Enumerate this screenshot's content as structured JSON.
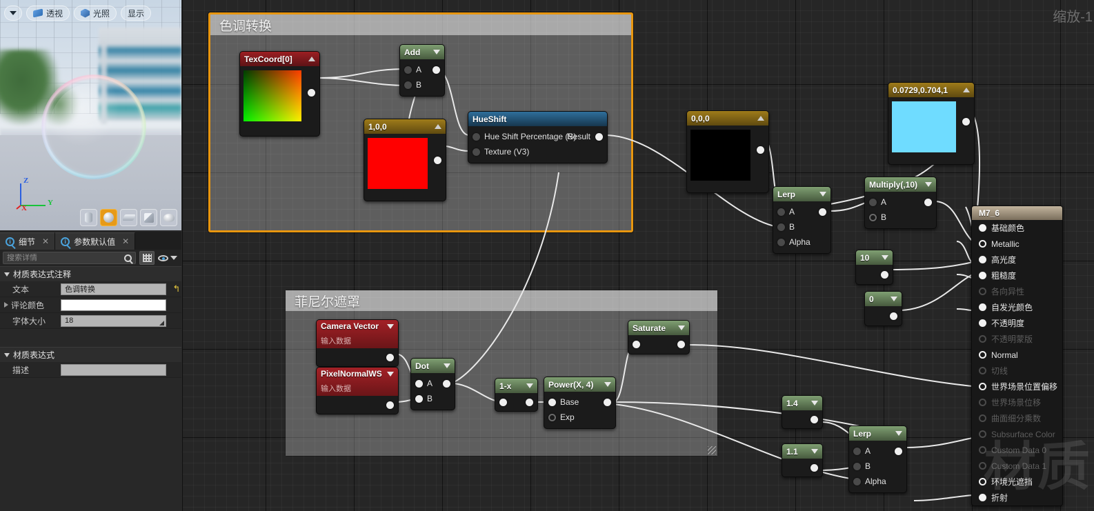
{
  "viewport": {
    "toolbar": [
      {
        "name": "view-menu-button",
        "icon": "caret-down-icon",
        "label": ""
      },
      {
        "name": "perspective-button",
        "icon": "perspective-icon",
        "label": "透视"
      },
      {
        "name": "lighting-button",
        "icon": "lighting-icon",
        "label": "光照"
      },
      {
        "name": "show-button",
        "icon": "",
        "label": "显示"
      }
    ],
    "gizmo": {
      "z": "Z",
      "y": "Y",
      "x": "X",
      "z_color": "#2b5fe0",
      "y_color": "#18c43a",
      "x_color": "#e02121"
    },
    "shapes": [
      {
        "name": "preview-cylinder",
        "active": false
      },
      {
        "name": "preview-sphere",
        "active": true
      },
      {
        "name": "preview-plane",
        "active": false
      },
      {
        "name": "preview-cube",
        "active": false
      },
      {
        "name": "preview-teapot",
        "active": false
      }
    ]
  },
  "details": {
    "tabs": [
      {
        "label": "细节",
        "close": "✕",
        "active": true
      },
      {
        "label": "参数默认值",
        "close": "✕",
        "active": false
      }
    ],
    "search": {
      "placeholder": "搜索详情",
      "value": ""
    },
    "sections": [
      {
        "title": "材质表达式注释",
        "rows": [
          {
            "label": "文本",
            "value": "色调转换",
            "style": "gray",
            "revert": "↰",
            "expand": false,
            "spinner": false
          },
          {
            "label": "评论颜色",
            "value": "",
            "style": "white",
            "revert": "",
            "expand": true,
            "spinner": false
          },
          {
            "label": "字体大小",
            "value": "18",
            "style": "gray",
            "revert": "",
            "expand": false,
            "spinner": true
          }
        ]
      },
      {
        "title": "材质表达式",
        "rows": [
          {
            "label": "描述",
            "value": "",
            "style": "gray",
            "revert": "",
            "expand": false,
            "spinner": false
          }
        ]
      }
    ]
  },
  "graph": {
    "zoom_label": "缩放-1",
    "watermark": "材质",
    "comments": [
      {
        "name": "comment-hue-shift",
        "title": "色调转换",
        "selected": true
      },
      {
        "name": "comment-fresnel-mask",
        "title": "菲尼尔遮罩",
        "selected": false
      }
    ],
    "nodes": {
      "texcoord": {
        "title": "TexCoord[0]",
        "caret": "up"
      },
      "add": {
        "title": "Add",
        "caret": "down",
        "in": [
          "A",
          "B"
        ]
      },
      "const_100": {
        "title": "1,0,0",
        "caret": "up"
      },
      "hueshift": {
        "title": "HueShift",
        "in": [
          "Hue Shift Percentage (S)",
          "Texture (V3)"
        ],
        "out": "Result"
      },
      "const_000": {
        "title": "0,0,0",
        "caret": "up"
      },
      "const_cyan": {
        "title": "0.0729,0.704,1",
        "caret": "up"
      },
      "lerp_top": {
        "title": "Lerp",
        "caret": "down",
        "in": [
          "A",
          "B",
          "Alpha"
        ]
      },
      "multiply_10": {
        "title": "Multiply(,10)",
        "caret": "down",
        "in": [
          "A",
          "B"
        ]
      },
      "const_10": {
        "title": "10",
        "caret": "down"
      },
      "const_0": {
        "title": "0",
        "caret": "down"
      },
      "camera_vector": {
        "title": "Camera Vector",
        "subtitle": "输入数据",
        "caret": "down"
      },
      "pixel_normal_ws": {
        "title": "PixelNormalWS",
        "subtitle": "输入数据",
        "caret": "down"
      },
      "dot": {
        "title": "Dot",
        "caret": "down",
        "in": [
          "A",
          "B"
        ]
      },
      "one_minus_x": {
        "title": "1-x",
        "caret": "down"
      },
      "power_x4": {
        "title": "Power(X, 4)",
        "caret": "down",
        "in": [
          "Base",
          "Exp"
        ]
      },
      "saturate": {
        "title": "Saturate",
        "caret": "down"
      },
      "const_14": {
        "title": "1.4",
        "caret": "down"
      },
      "const_11": {
        "title": "1.1",
        "caret": "down"
      },
      "lerp_bottom": {
        "title": "Lerp",
        "caret": "down",
        "in": [
          "A",
          "B",
          "Alpha"
        ]
      }
    },
    "material_output": {
      "title": "M7_6",
      "pins": [
        {
          "label": "基础颜色",
          "filled": true,
          "enabled": true
        },
        {
          "label": "Metallic",
          "filled": false,
          "enabled": true
        },
        {
          "label": "高光度",
          "filled": true,
          "enabled": true
        },
        {
          "label": "粗糙度",
          "filled": true,
          "enabled": true
        },
        {
          "label": "各向异性",
          "filled": false,
          "enabled": false
        },
        {
          "label": "自发光颜色",
          "filled": true,
          "enabled": true
        },
        {
          "label": "不透明度",
          "filled": true,
          "enabled": true
        },
        {
          "label": "不透明蒙版",
          "filled": false,
          "enabled": false
        },
        {
          "label": "Normal",
          "filled": false,
          "enabled": true
        },
        {
          "label": "切线",
          "filled": false,
          "enabled": false
        },
        {
          "label": "世界场景位置偏移",
          "filled": false,
          "enabled": true
        },
        {
          "label": "世界场景位移",
          "filled": false,
          "enabled": false
        },
        {
          "label": "曲面细分乘数",
          "filled": false,
          "enabled": false
        },
        {
          "label": "Subsurface Color",
          "filled": false,
          "enabled": false
        },
        {
          "label": "Custom Data 0",
          "filled": false,
          "enabled": false
        },
        {
          "label": "Custom Data 1",
          "filled": false,
          "enabled": false
        },
        {
          "label": "环境光遮挡",
          "filled": false,
          "enabled": true
        },
        {
          "label": "折射",
          "filled": true,
          "enabled": true
        }
      ]
    }
  },
  "colors": {
    "accent_orange": "#e8960f",
    "graph_bg": "#262626",
    "node_green": "#7f9f72",
    "node_red": "#9c1f23",
    "node_gold": "#9e7b1a",
    "node_blue": "#2f6f9c",
    "swatch_red": "#ff0000",
    "swatch_black": "#000000",
    "swatch_cyan": "#6fdcff"
  }
}
